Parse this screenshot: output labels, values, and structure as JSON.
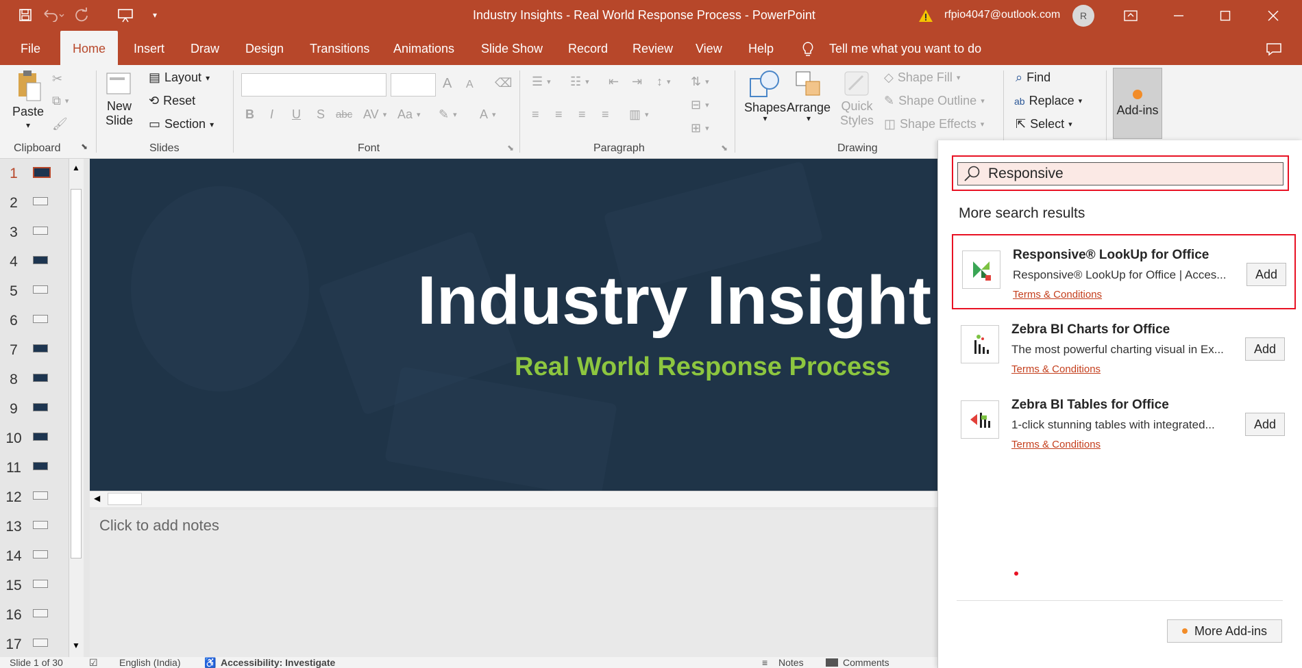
{
  "window": {
    "title": "Industry Insights - Real World Response Process  -  PowerPoint",
    "account": "rfpio4047@outlook.com",
    "avatar_initial": "R"
  },
  "menu": {
    "tabs": [
      "File",
      "Home",
      "Insert",
      "Draw",
      "Design",
      "Transitions",
      "Animations",
      "Slide Show",
      "Record",
      "Review",
      "View",
      "Help"
    ],
    "tell_me": "Tell me what you want to do"
  },
  "ribbon": {
    "clipboard": {
      "paste": "Paste",
      "group": "Clipboard"
    },
    "slides": {
      "new_slide_1": "New",
      "new_slide_2": "Slide",
      "layout": "Layout",
      "reset": "Reset",
      "section": "Section",
      "group": "Slides"
    },
    "font": {
      "bold": "B",
      "italic": "I",
      "underline": "U",
      "strike": "S",
      "abc": "abc",
      "av": "AV",
      "aa": "Aa",
      "a_color": "A",
      "grow": "A",
      "shrink": "A",
      "group": "Font"
    },
    "paragraph": {
      "group": "Paragraph"
    },
    "drawing": {
      "shapes": "Shapes",
      "arrange": "Arrange",
      "quick_1": "Quick",
      "quick_2": "Styles",
      "fill": "Shape Fill",
      "outline": "Shape Outline",
      "effects": "Shape Effects",
      "group": "Drawing"
    },
    "editing": {
      "find": "Find",
      "replace": "Replace",
      "select": "Select"
    },
    "addins": {
      "label": "Add-ins"
    }
  },
  "thumbnails": {
    "numbers": [
      "1",
      "2",
      "3",
      "4",
      "5",
      "6",
      "7",
      "8",
      "9",
      "10",
      "11",
      "12",
      "13",
      "14",
      "15",
      "16",
      "17"
    ]
  },
  "slide": {
    "title": "Industry Insight",
    "subtitle": "Real World Response Process"
  },
  "notes": {
    "placeholder": "Click to add notes"
  },
  "statusbar": {
    "slide_count": "Slide 1 of 30",
    "language": "English (India)",
    "accessibility": "Accessibility: Investigate",
    "notes": "Notes",
    "comments": "Comments"
  },
  "addins_panel": {
    "search_value": "Responsive",
    "section_title": "More search results",
    "results": [
      {
        "title": "Responsive® LookUp for Office",
        "desc": "Responsive® LookUp for Office | Acces...",
        "terms": "Terms & Conditions",
        "add": "Add"
      },
      {
        "title": "Zebra BI Charts for Office",
        "desc": "The most powerful charting visual in Ex...",
        "terms": "Terms & Conditions",
        "add": "Add"
      },
      {
        "title": "Zebra BI Tables for Office",
        "desc": "1-click stunning tables with integrated...",
        "terms": "Terms & Conditions",
        "add": "Add"
      }
    ],
    "more_addins": "More Add-ins"
  },
  "colors": {
    "accent": "#b7472a",
    "highlight": "#e81123",
    "subtitle_green": "#8dc63f"
  }
}
